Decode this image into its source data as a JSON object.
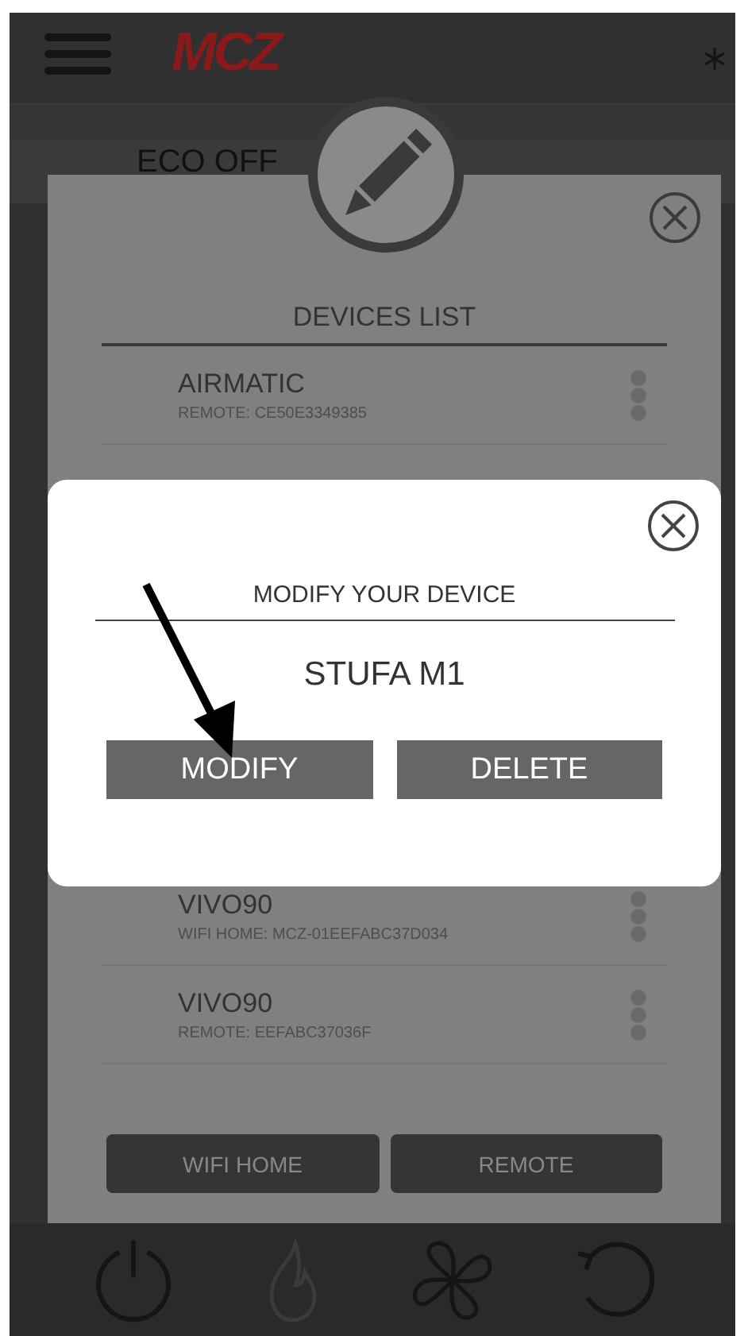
{
  "header": {
    "logo": "MCZ"
  },
  "status": {
    "mode": "ECO OFF"
  },
  "devices_panel": {
    "title": "DEVICES LIST",
    "items_above_dialog": [
      {
        "name": "AIRMATIC",
        "detail": "REMOTE: CE50E3349385"
      }
    ],
    "items_below_dialog": [
      {
        "name": "VIVO90",
        "detail": "WIFI HOME: MCZ-01EEFABC37D034"
      },
      {
        "name": "VIVO90",
        "detail": "REMOTE: EEFABC37036F"
      }
    ],
    "buttons": [
      "WIFI HOME",
      "REMOTE"
    ]
  },
  "dialog": {
    "title": "MODIFY YOUR DEVICE",
    "device": "STUFA M1",
    "buttons": [
      "MODIFY",
      "DELETE"
    ]
  },
  "bottom_bar": [
    {
      "kind": "power",
      "disabled": false
    },
    {
      "kind": "flame",
      "disabled": true
    },
    {
      "kind": "fan",
      "disabled": false
    },
    {
      "kind": "refresh",
      "disabled": false
    }
  ]
}
